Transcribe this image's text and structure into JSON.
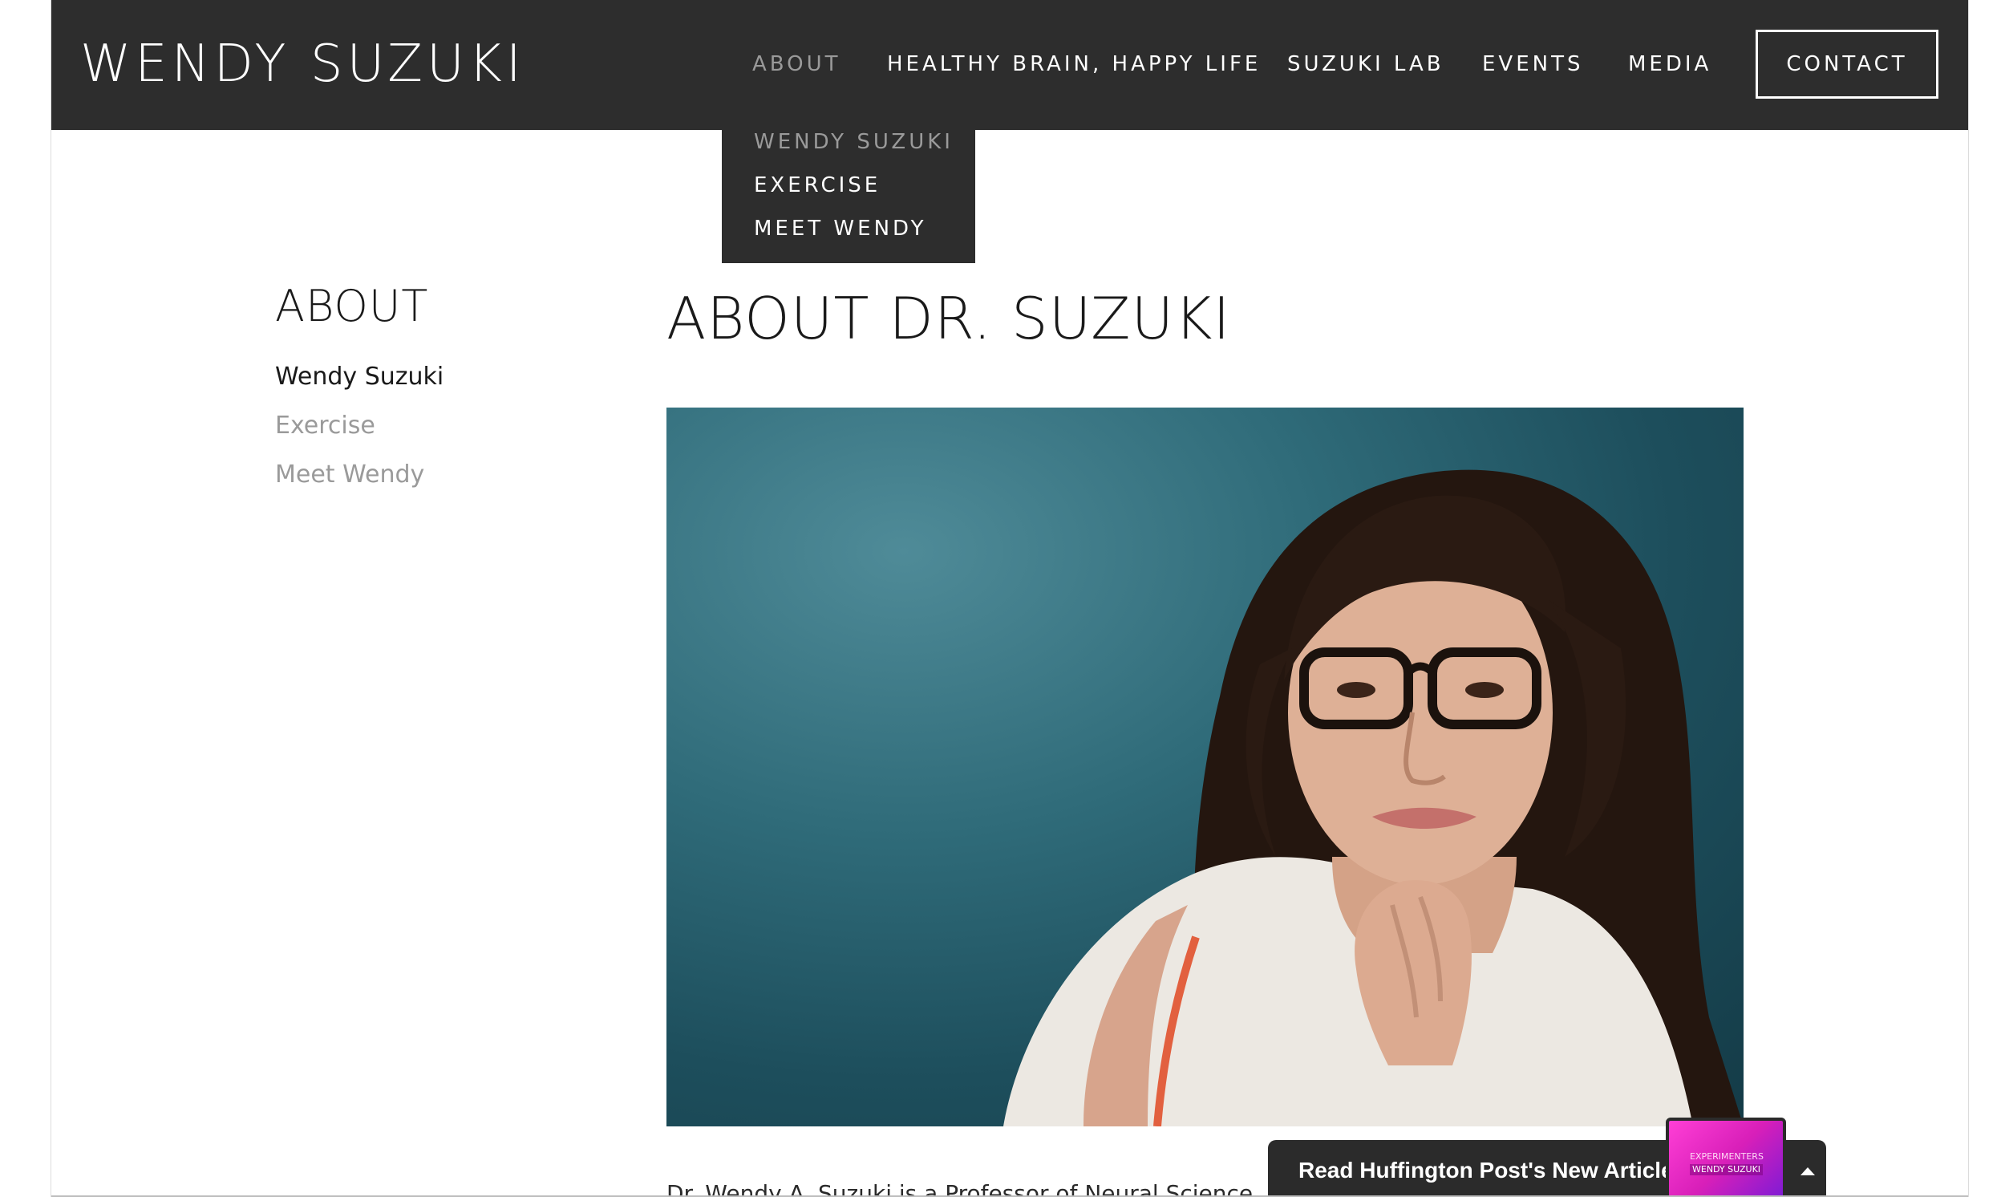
{
  "header": {
    "logo": "WENDY SUZUKI",
    "nav": [
      {
        "label": "ABOUT",
        "active": true
      },
      {
        "label": "HEALTHY BRAIN, HAPPY LIFE",
        "active": false
      },
      {
        "label": "SUZUKI LAB",
        "active": false
      },
      {
        "label": "EVENTS",
        "active": false
      },
      {
        "label": "MEDIA",
        "active": false
      }
    ],
    "contact_label": "CONTACT"
  },
  "dropdown": {
    "items": [
      {
        "label": "WENDY SUZUKI",
        "active": true
      },
      {
        "label": "EXERCISE",
        "active": false
      },
      {
        "label": "MEET WENDY",
        "active": false
      }
    ]
  },
  "sidebar": {
    "title": "ABOUT",
    "links": [
      {
        "label": "Wendy Suzuki",
        "active": true
      },
      {
        "label": "Exercise",
        "active": false
      },
      {
        "label": "Meet Wendy",
        "active": false
      }
    ]
  },
  "main": {
    "title": "ABOUT DR. SUZUKI",
    "body_start": "Dr. Wendy A. Suzuki is a Professor of Neural Science"
  },
  "promo": {
    "text": "Read Huffington Post's New Article",
    "thumb_label": "EXPERIMENTERS",
    "thumb_name": "WENDY SUZUKI",
    "caret_icon": "caret-up-icon"
  },
  "colors": {
    "header_bg": "#2d2d2d",
    "nav_text": "#ffffff",
    "nav_active": "#9a9a9a",
    "sidebar_inactive": "#9a9a9a",
    "photo_backdrop": "#2f6b79"
  }
}
